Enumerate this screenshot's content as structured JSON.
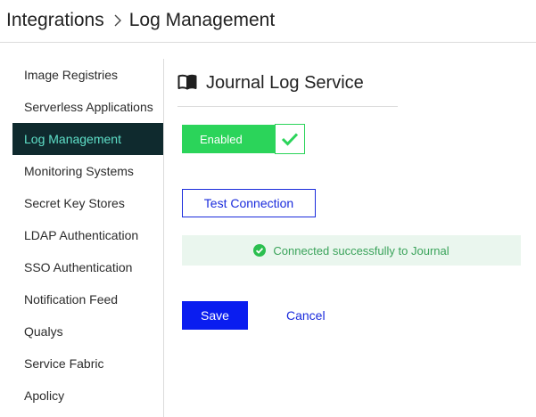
{
  "breadcrumb": {
    "parent": "Integrations",
    "current": "Log Management"
  },
  "sidebar": {
    "items": [
      {
        "label": "Image Registries",
        "active": false
      },
      {
        "label": "Serverless Applications",
        "active": false
      },
      {
        "label": "Log Management",
        "active": true
      },
      {
        "label": "Monitoring Systems",
        "active": false
      },
      {
        "label": "Secret Key Stores",
        "active": false
      },
      {
        "label": "LDAP Authentication",
        "active": false
      },
      {
        "label": "SSO Authentication",
        "active": false
      },
      {
        "label": "Notification Feed",
        "active": false
      },
      {
        "label": "Qualys",
        "active": false
      },
      {
        "label": "Service Fabric",
        "active": false
      },
      {
        "label": "Apolicy",
        "active": false
      }
    ]
  },
  "main": {
    "title": "Journal Log Service",
    "title_icon": "book-icon",
    "toggle": {
      "label": "Enabled",
      "state": true,
      "icon": "checkmark-icon"
    },
    "test_button": "Test Connection",
    "status": {
      "text": "Connected successfully to Journal",
      "icon": "check-circle-icon"
    },
    "save_button": "Save",
    "cancel_button": "Cancel"
  },
  "colors": {
    "active_bg": "#0f2a2e",
    "active_text": "#5fe0c9",
    "toggle_green": "#2bd45a",
    "primary_blue": "#0a1df0",
    "link_blue": "#1a2bdc",
    "success_bg": "#eaf6ee",
    "success_text": "#3aa35a"
  }
}
